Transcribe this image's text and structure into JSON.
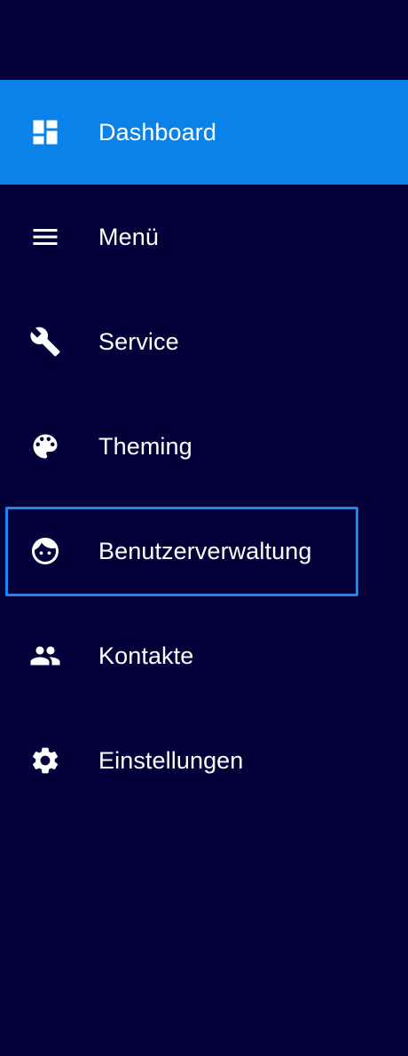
{
  "sidebar": {
    "items": [
      {
        "label": "Dashboard",
        "icon": "dashboard-icon",
        "active": true
      },
      {
        "label": "Menü",
        "icon": "menu-icon"
      },
      {
        "label": "Service",
        "icon": "wrench-icon"
      },
      {
        "label": "Theming",
        "icon": "palette-icon"
      },
      {
        "label": "Benutzerverwaltung",
        "icon": "face-icon",
        "focused": true
      },
      {
        "label": "Kontakte",
        "icon": "people-icon"
      },
      {
        "label": "Einstellungen",
        "icon": "gear-icon"
      }
    ]
  },
  "colors": {
    "background": "#03003a",
    "active": "#0a82ea",
    "focus_outline": "#1a86f0",
    "text": "#ffffff"
  }
}
